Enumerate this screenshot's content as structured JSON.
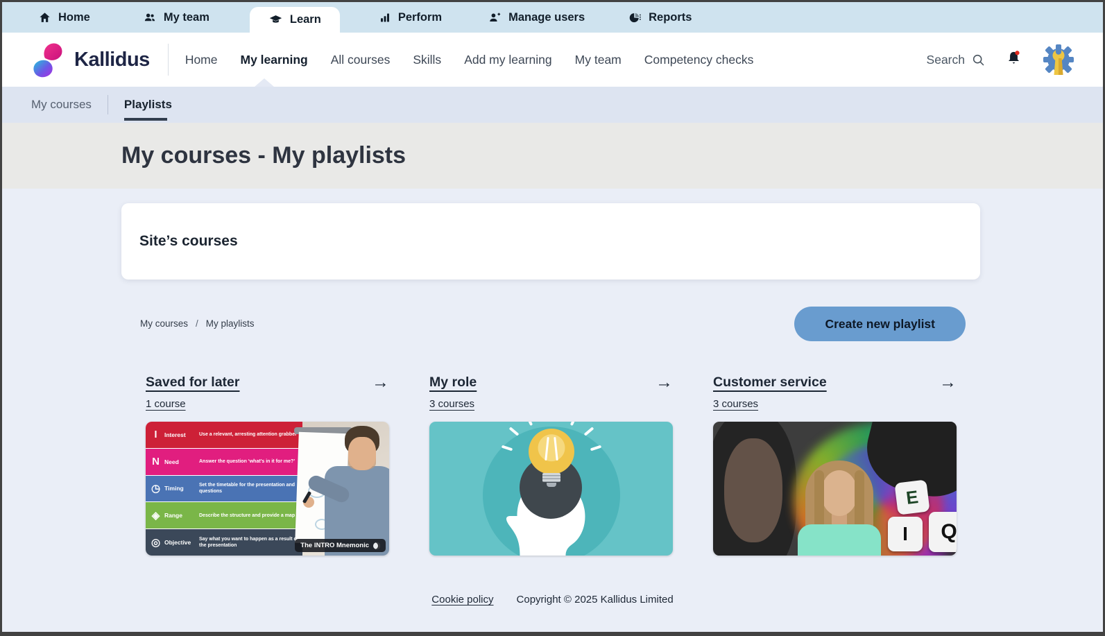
{
  "app_tabs": {
    "home": "Home",
    "my_team": "My team",
    "learn": "Learn",
    "perform": "Perform",
    "manage_users": "Manage users",
    "reports": "Reports"
  },
  "header": {
    "brand": "Kallidus",
    "nav": {
      "home": "Home",
      "my_learning": "My learning",
      "all_courses": "All courses",
      "skills": "Skills",
      "add_my_learning": "Add my learning",
      "my_team": "My team",
      "competency_checks": "Competency checks"
    },
    "search_label": "Search"
  },
  "subnav": {
    "my_courses": "My courses",
    "playlists": "Playlists"
  },
  "page": {
    "title": "My courses - My playlists"
  },
  "site_card": {
    "title": "Site’s courses"
  },
  "breadcrumb": {
    "first": "My courses",
    "separator": "/",
    "second": "My playlists"
  },
  "actions": {
    "create_playlist": "Create new playlist"
  },
  "icons": {
    "arrow": "→"
  },
  "playlists": {
    "saved": {
      "title": "Saved for later",
      "count": "1 course"
    },
    "role": {
      "title": "My role",
      "count": "3 courses"
    },
    "customer": {
      "title": "Customer service",
      "count": "3 courses"
    }
  },
  "intro_course": {
    "badge": "The INTRO Mnemonic",
    "rows": [
      {
        "icon": "I",
        "label": "Interest",
        "desc": "Use a relevant, arresting attention grabber",
        "color": "#cd2037"
      },
      {
        "icon": "N",
        "label": "Need",
        "desc": "Answer the question ‘what’s in it for me?’",
        "color": "#e11e7f"
      },
      {
        "icon": "◷",
        "label": "Timing",
        "desc": "Set the timetable for the presentation and questions",
        "color": "#4a73b4"
      },
      {
        "icon": "◈",
        "label": "Range",
        "desc": "Describe the structure and provide a map",
        "color": "#7ab648"
      },
      {
        "icon": "◎",
        "label": "Objective",
        "desc": "Say what you want to happen as a result of the presentation",
        "color": "#3b4859"
      }
    ]
  },
  "eq_dice": {
    "letters": [
      "E",
      "I",
      "Q"
    ]
  },
  "footer": {
    "cookie": "Cookie policy",
    "copyright": "Copyright © 2025 Kallidus Limited"
  },
  "colors": {
    "accent_blue": "#699ccf",
    "topbar": "#cfe3ef",
    "subnav": "#dde4f1",
    "notification": "#e02b20"
  }
}
